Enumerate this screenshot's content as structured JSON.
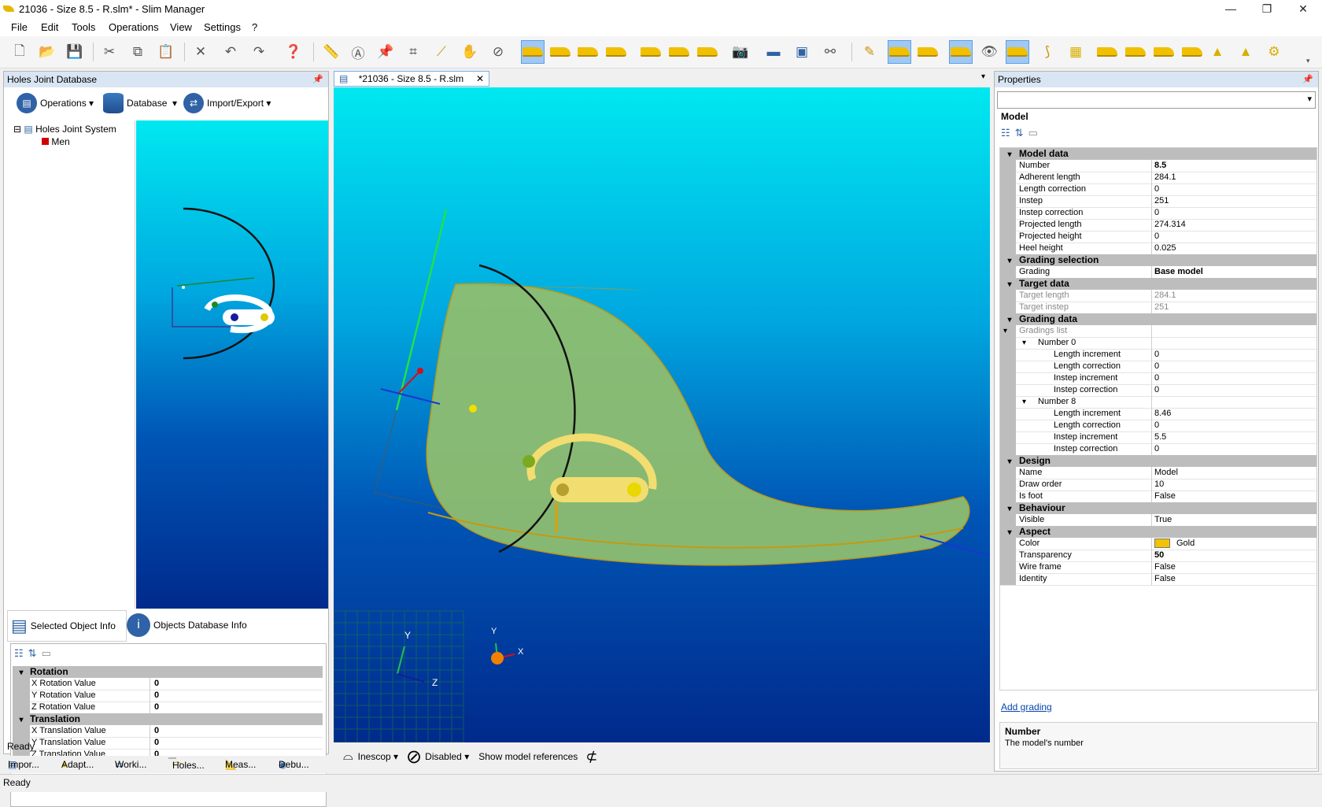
{
  "window": {
    "title": "21036 - Size 8.5 - R.slm* - Slim Manager",
    "minimize": "—",
    "maximize": "❐",
    "close": "✕"
  },
  "menu": [
    "File",
    "Edit",
    "Tools",
    "Operations",
    "View",
    "Settings",
    "?"
  ],
  "left_panel": {
    "title": "Holes Joint Database",
    "operations": "Operations",
    "database": "Database",
    "import_export": "Import/Export",
    "tree_root": "Holes Joint System",
    "tree_child": "Men",
    "tab_selected": "Selected Object Info",
    "tab_objects": "Objects Database Info",
    "sections": [
      {
        "name": "Rotation",
        "rows": [
          [
            "X Rotation Value",
            "0"
          ],
          [
            "Y Rotation Value",
            "0"
          ],
          [
            "Z Rotation Value",
            "0"
          ]
        ]
      },
      {
        "name": "Translation",
        "rows": [
          [
            "X Translation Value",
            "0"
          ],
          [
            "Y Translation Value",
            "0"
          ],
          [
            "Z Translation Value",
            "0"
          ]
        ]
      }
    ],
    "ready": "Ready"
  },
  "bottom_tabs": [
    "Impor...",
    "Adapt...",
    "Worki...",
    "Holes...",
    "Meas...",
    "Debu..."
  ],
  "document": {
    "tab_title": "*21036 - Size 8.5 - R.slm",
    "axis_x": "X",
    "axis_y": "Y",
    "axis_z": "Z",
    "inescop": "Inescop",
    "disabled": "Disabled",
    "show_refs": "Show model references"
  },
  "properties": {
    "title": "Properties",
    "object": "Model",
    "add_grading": "Add grading",
    "help_title": "Number",
    "help_text": "The model's number",
    "color_hex": "#f2c300",
    "rows": [
      {
        "t": "cat",
        "l": "Model data"
      },
      {
        "t": "p",
        "l": "Number",
        "v": "8.5",
        "b": true
      },
      {
        "t": "p",
        "l": "Adherent length",
        "v": "284.1"
      },
      {
        "t": "p",
        "l": "Length correction",
        "v": "0"
      },
      {
        "t": "p",
        "l": "Instep",
        "v": "251"
      },
      {
        "t": "p",
        "l": "Instep correction",
        "v": "0"
      },
      {
        "t": "p",
        "l": "Projected length",
        "v": "274.314"
      },
      {
        "t": "p",
        "l": "Projected height",
        "v": "0"
      },
      {
        "t": "p",
        "l": "Heel height",
        "v": "0.025"
      },
      {
        "t": "cat",
        "l": "Grading selection"
      },
      {
        "t": "p",
        "l": "Grading",
        "v": "Base model",
        "b": true
      },
      {
        "t": "cat",
        "l": "Target data"
      },
      {
        "t": "p",
        "l": "Target length",
        "v": "284.1",
        "g": true
      },
      {
        "t": "p",
        "l": "Target instep",
        "v": "251",
        "g": true
      },
      {
        "t": "cat",
        "l": "Grading data"
      },
      {
        "t": "sub",
        "l": "Gradings list",
        "v": "",
        "g": true
      },
      {
        "t": "sub2",
        "l": "Number 0"
      },
      {
        "t": "p3",
        "l": "Length increment",
        "v": "0"
      },
      {
        "t": "p3",
        "l": "Length correction",
        "v": "0"
      },
      {
        "t": "p3",
        "l": "Instep increment",
        "v": "0"
      },
      {
        "t": "p3",
        "l": "Instep correction",
        "v": "0"
      },
      {
        "t": "sub2",
        "l": "Number 8"
      },
      {
        "t": "p3",
        "l": "Length increment",
        "v": "8.46"
      },
      {
        "t": "p3",
        "l": "Length correction",
        "v": "0"
      },
      {
        "t": "p3",
        "l": "Instep increment",
        "v": "5.5"
      },
      {
        "t": "p3",
        "l": "Instep correction",
        "v": "0"
      },
      {
        "t": "cat",
        "l": "Design"
      },
      {
        "t": "p",
        "l": "Name",
        "v": "Model"
      },
      {
        "t": "p",
        "l": "Draw order",
        "v": "10"
      },
      {
        "t": "p",
        "l": "Is foot",
        "v": "False"
      },
      {
        "t": "cat",
        "l": "Behaviour"
      },
      {
        "t": "p",
        "l": "Visible",
        "v": "True"
      },
      {
        "t": "cat",
        "l": "Aspect"
      },
      {
        "t": "p",
        "l": "Color",
        "v": "Gold",
        "swatch": true
      },
      {
        "t": "p",
        "l": "Transparency",
        "v": "50",
        "b": true
      },
      {
        "t": "p",
        "l": "Wire frame",
        "v": "False"
      },
      {
        "t": "p",
        "l": "Identity",
        "v": "False"
      }
    ]
  },
  "status": "Ready"
}
